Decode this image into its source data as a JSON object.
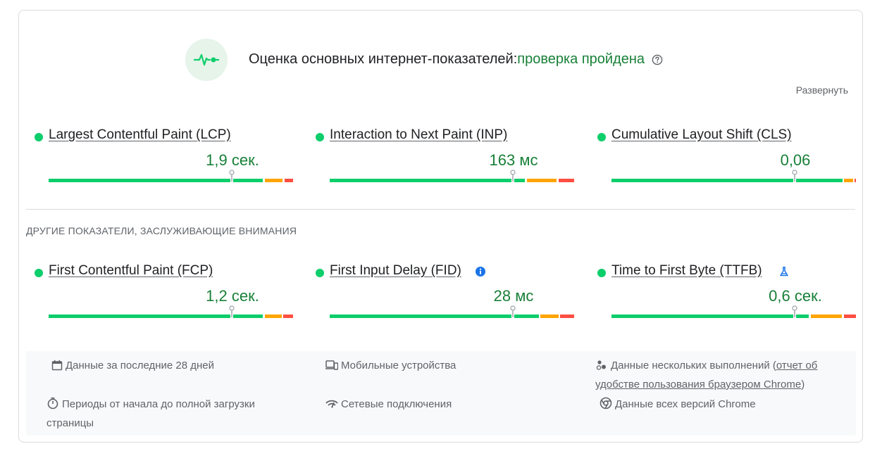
{
  "assessment": {
    "title": "Оценка основных интернет-показателей:",
    "result": "проверка пройдена",
    "expand_label": "Развернуть"
  },
  "core_metrics": [
    {
      "name": "Largest Contentful Paint (LCP)",
      "value": "1,9 сек.",
      "percentile": 0.75
    },
    {
      "name": "Interaction to Next Paint (INP)",
      "value": "163 мс",
      "percentile": 0.75
    },
    {
      "name": "Cumulative Layout Shift (CLS)",
      "value": "0,06",
      "percentile": 0.75
    }
  ],
  "other_section_title": "ДРУГИЕ ПОКАЗАТЕЛИ, ЗАСЛУЖИВАЮЩИЕ ВНИМАНИЯ",
  "other_metrics": [
    {
      "name": "First Contentful Paint (FCP)",
      "value": "1,2 сек.",
      "percentile": 0.75
    },
    {
      "name": "First Input Delay (FID)",
      "value": "28 мс",
      "percentile": 0.75,
      "badge": "info-icon"
    },
    {
      "name": "Time to First Byte (TTFB)",
      "value": "0,6 сек.",
      "percentile": 0.75,
      "badge": "flask-icon"
    }
  ],
  "footer": {
    "period": "Данные за последние 28 дней",
    "devices": "Мобильные устройства",
    "runs_prefix": "Данные нескольких выполнений (",
    "runs_link": "отчет об удобстве пользования браузером Chrome",
    "runs_suffix": ")",
    "loading": "Периоды от начала до полной загрузки страницы",
    "network": "Сетевые подключения",
    "versions": "Данные всех версий Chrome"
  },
  "colors": {
    "good": "#0cce6b",
    "needs_improvement": "#ffa400",
    "poor": "#ff4e42",
    "pass_text": "#188038",
    "info": "#1a73e8"
  }
}
